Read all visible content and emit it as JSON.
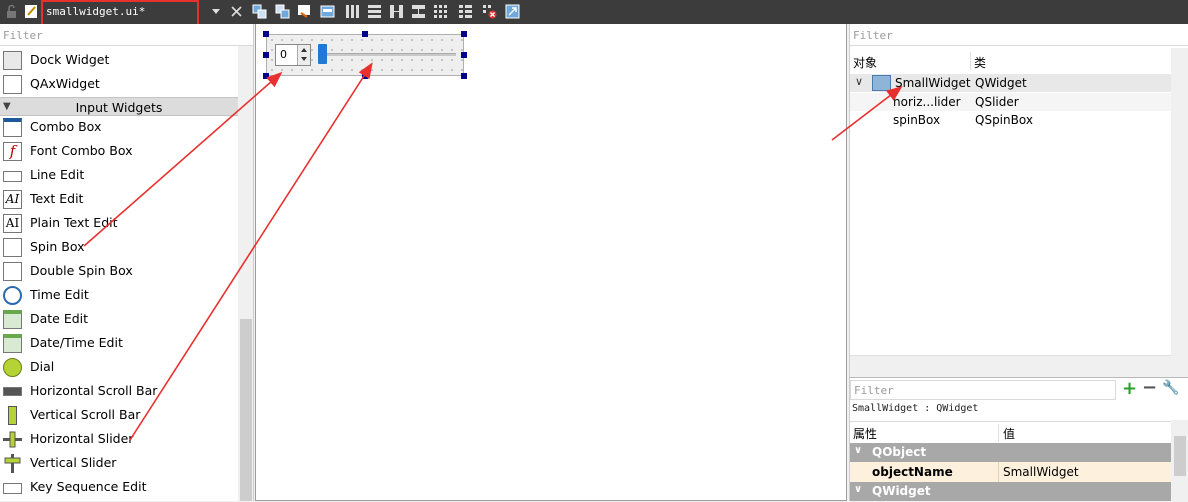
{
  "toolbar": {
    "file_name": "smallwidget.ui*",
    "tools": [
      "lock-icon",
      "edit-widgets-icon",
      "close-icon",
      "edit-signals-slots-icon",
      "edit-buddies-icon",
      "edit-tab-order-icon",
      "edit-resources-icon",
      "lay-out-horizontally-icon",
      "lay-out-vertically-icon",
      "lay-out-horizontal-splitter-icon",
      "lay-out-vertical-splitter-icon",
      "lay-out-grid-icon",
      "lay-out-form-icon",
      "break-layout-icon",
      "adjust-size-icon"
    ]
  },
  "widget_box": {
    "filter_placeholder": "Filter",
    "category": "Input Widgets",
    "items_before": [
      {
        "label": "Dock Widget",
        "icon": "dock-widget-icon"
      },
      {
        "label": "QAxWidget",
        "icon": "qaxwidget-icon"
      }
    ],
    "items": [
      {
        "label": "Combo Box",
        "icon": "combo-box-icon"
      },
      {
        "label": "Font Combo Box",
        "icon": "font-combo-box-icon"
      },
      {
        "label": "Line Edit",
        "icon": "line-edit-icon"
      },
      {
        "label": "Text Edit",
        "icon": "text-edit-icon"
      },
      {
        "label": "Plain Text Edit",
        "icon": "plain-text-edit-icon"
      },
      {
        "label": "Spin Box",
        "icon": "spin-box-icon"
      },
      {
        "label": "Double Spin Box",
        "icon": "double-spin-box-icon"
      },
      {
        "label": "Time Edit",
        "icon": "time-edit-icon"
      },
      {
        "label": "Date Edit",
        "icon": "date-edit-icon"
      },
      {
        "label": "Date/Time Edit",
        "icon": "date-time-edit-icon"
      },
      {
        "label": "Dial",
        "icon": "dial-icon"
      },
      {
        "label": "Horizontal Scroll Bar",
        "icon": "horizontal-scroll-bar-icon"
      },
      {
        "label": "Vertical Scroll Bar",
        "icon": "vertical-scroll-bar-icon"
      },
      {
        "label": "Horizontal Slider",
        "icon": "horizontal-slider-icon"
      },
      {
        "label": "Vertical Slider",
        "icon": "vertical-slider-icon"
      },
      {
        "label": "Key Sequence Edit",
        "icon": "key-sequence-edit-icon"
      }
    ]
  },
  "canvas": {
    "spinbox_value": "0"
  },
  "object_inspector": {
    "filter_placeholder": "Filter",
    "col_object": "对象",
    "col_class": "类",
    "rows": [
      {
        "name": "SmallWidget",
        "cls": "QWidget"
      },
      {
        "name": "horiz...lider",
        "cls": "QSlider"
      },
      {
        "name": "spinBox",
        "cls": "QSpinBox"
      }
    ]
  },
  "property_editor": {
    "filter_placeholder": "Filter",
    "class_line": "SmallWidget : QWidget",
    "col_property": "属性",
    "col_value": "值",
    "group_qobject": "QObject",
    "object_name_key": "objectName",
    "object_name_value": "SmallWidget",
    "group_qwidget": "QWidget"
  },
  "colors": {
    "annotation_red": "#e8312f",
    "selection_handle": "#00008b",
    "slider_accent": "#1e7ad6"
  }
}
